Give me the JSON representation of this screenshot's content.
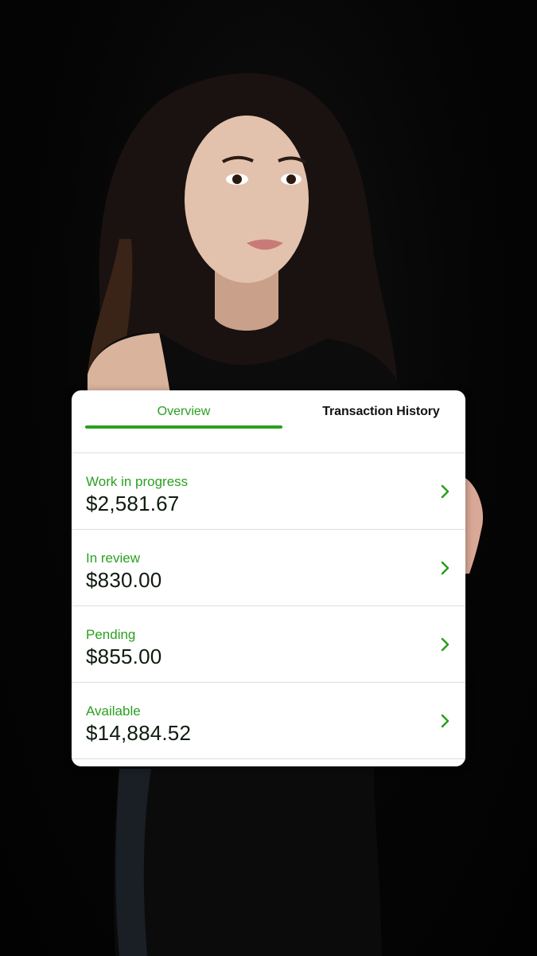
{
  "tabs": [
    {
      "label": "Overview",
      "active": true
    },
    {
      "label": "Transaction History",
      "active": false
    }
  ],
  "rows": [
    {
      "label": "Work in progress",
      "amount": "$2,581.67"
    },
    {
      "label": "In review",
      "amount": "$830.00"
    },
    {
      "label": "Pending",
      "amount": "$855.00"
    },
    {
      "label": "Available",
      "amount": "$14,884.52"
    }
  ],
  "colors": {
    "accent": "#2ba01f",
    "background": "#050505",
    "card": "#ffffff"
  },
  "icons": {
    "row_chevron": "chevron-right-icon"
  }
}
